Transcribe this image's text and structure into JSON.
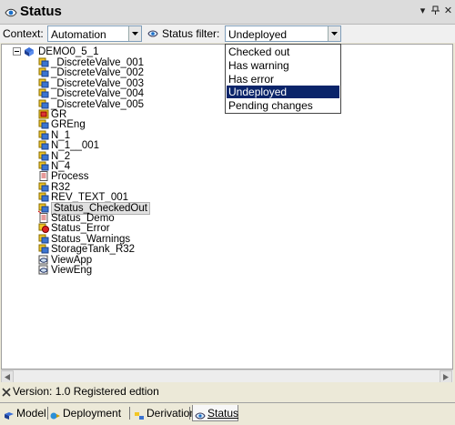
{
  "window": {
    "title": "Status"
  },
  "toolbar": {
    "context_label": "Context:",
    "context_value": "Automation",
    "status_filter_label": "Status filter:",
    "status_filter_value": "Undeployed"
  },
  "filter_options": [
    {
      "label": "Checked out",
      "selected": false
    },
    {
      "label": "Has warning",
      "selected": false
    },
    {
      "label": "Has error",
      "selected": false
    },
    {
      "label": "Undeployed",
      "selected": true
    },
    {
      "label": "Pending changes",
      "selected": false
    }
  ],
  "tree": {
    "root": {
      "label": "DEMO0_5_1",
      "icon": "project-icon"
    },
    "items": [
      {
        "label": "_DiscreteValve_001",
        "icon": "object-icon"
      },
      {
        "label": "_DiscreteValve_002",
        "icon": "object-icon"
      },
      {
        "label": "_DiscreteValve_003",
        "icon": "object-icon"
      },
      {
        "label": "_DiscreteValve_004",
        "icon": "object-icon"
      },
      {
        "label": "_DiscreteValve_005",
        "icon": "object-icon"
      },
      {
        "label": "GR",
        "icon": "group-icon"
      },
      {
        "label": "GREng",
        "icon": "object-icon"
      },
      {
        "label": "N_1",
        "icon": "object-icon"
      },
      {
        "label": "N_1__001",
        "icon": "object-icon"
      },
      {
        "label": "N_2",
        "icon": "object-icon"
      },
      {
        "label": "N_4",
        "icon": "object-icon"
      },
      {
        "label": "Process",
        "icon": "document-icon"
      },
      {
        "label": "R32",
        "icon": "object-icon"
      },
      {
        "label": "REV_TEXT_001",
        "icon": "object-icon"
      },
      {
        "label": "Status_CheckedOut",
        "icon": "checked-out-icon"
      },
      {
        "label": "Status_Demo",
        "icon": "document-icon"
      },
      {
        "label": "Status_Error",
        "icon": "error-icon"
      },
      {
        "label": "Status_Warnings",
        "icon": "object-icon"
      },
      {
        "label": "StorageTank_R32",
        "icon": "object-icon"
      },
      {
        "label": "ViewApp",
        "icon": "view-icon"
      },
      {
        "label": "ViewEng",
        "icon": "view-icon"
      }
    ]
  },
  "status_bar": {
    "text": "Version:  1.0  Registered edtion"
  },
  "tabs": [
    {
      "label": "Model",
      "icon": "model-icon",
      "active": false
    },
    {
      "label": "Deployment",
      "icon": "deployment-icon",
      "active": false
    },
    {
      "label": "Derivation",
      "icon": "derivation-icon",
      "active": false
    },
    {
      "label": "Status",
      "icon": "status-icon",
      "active": true
    }
  ],
  "colors": {
    "selection": "#0a246a",
    "tree_background": "#ffffff",
    "chrome": "#ece9d8"
  }
}
